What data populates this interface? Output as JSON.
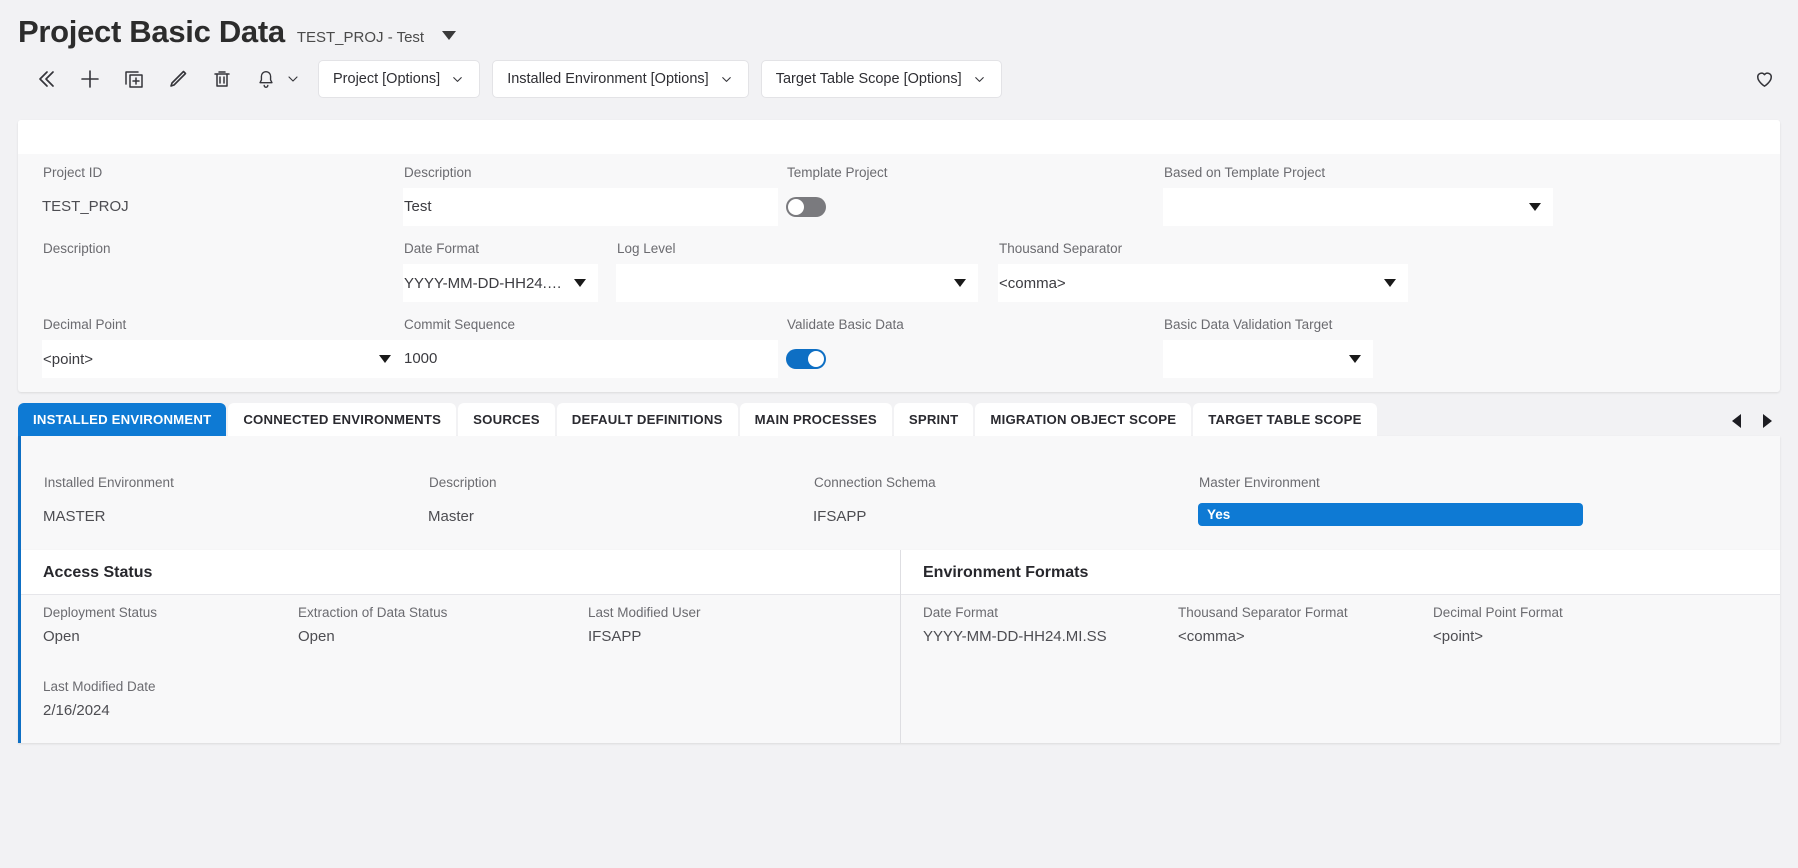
{
  "header": {
    "title": "Project Basic Data",
    "subtitle": "TEST_PROJ - Test"
  },
  "toolbar": {
    "icons": [
      {
        "name": "collapse-icon",
        "glyph": "chevrons-left"
      },
      {
        "name": "new-icon",
        "glyph": "plus"
      },
      {
        "name": "duplicate-icon",
        "glyph": "copy-plus"
      },
      {
        "name": "edit-icon",
        "glyph": "pencil"
      },
      {
        "name": "delete-icon",
        "glyph": "trash"
      },
      {
        "name": "notification-icon",
        "glyph": "bell"
      }
    ],
    "option_buttons": [
      "Project [Options]",
      "Installed Environment [Options]",
      "Target Table Scope [Options]"
    ],
    "favorite_icon": "heart-icon"
  },
  "form": {
    "row1": [
      {
        "label": "Project ID",
        "value": "TEST_PROJ",
        "type": "readonly"
      },
      {
        "label": "Description",
        "value": "Test",
        "type": "input"
      },
      {
        "label": "Template Project",
        "value": "",
        "type": "toggle",
        "on": false
      },
      {
        "label": "Based on Template Project",
        "value": "",
        "type": "select"
      }
    ],
    "row2": [
      {
        "label": "Description",
        "value": "",
        "type": "readonly"
      },
      {
        "label": "Date Format",
        "value": "YYYY-MM-DD-HH24.MI...",
        "type": "select"
      },
      {
        "label": "Log Level",
        "value": "",
        "type": "select"
      },
      {
        "label": "Thousand Separator",
        "value": "<comma>",
        "type": "select"
      }
    ],
    "row3": [
      {
        "label": "Decimal Point",
        "value": "<point>",
        "type": "select"
      },
      {
        "label": "Commit Sequence",
        "value": "1000",
        "type": "input"
      },
      {
        "label": "Validate Basic Data",
        "value": "",
        "type": "toggle",
        "on": true
      },
      {
        "label": "Basic Data Validation Target",
        "value": "",
        "type": "select"
      }
    ]
  },
  "tabs": [
    {
      "label": "INSTALLED ENVIRONMENT",
      "active": true
    },
    {
      "label": "CONNECTED ENVIRONMENTS",
      "active": false
    },
    {
      "label": "SOURCES",
      "active": false
    },
    {
      "label": "DEFAULT DEFINITIONS",
      "active": false
    },
    {
      "label": "MAIN PROCESSES",
      "active": false
    },
    {
      "label": "SPRINT",
      "active": false
    },
    {
      "label": "MIGRATION OBJECT SCOPE",
      "active": false
    },
    {
      "label": "TARGET TABLE SCOPE",
      "active": false
    }
  ],
  "tab_nav": {
    "prev_icon": "arrow-left-icon",
    "next_icon": "arrow-right-icon"
  },
  "installed_environment": {
    "fields": [
      {
        "label": "Installed Environment",
        "value": "MASTER"
      },
      {
        "label": "Description",
        "value": "Master"
      },
      {
        "label": "Connection Schema",
        "value": "IFSAPP"
      },
      {
        "label": "Master Environment",
        "value": "Yes",
        "badge": true
      }
    ]
  },
  "access_status": {
    "title": "Access Status",
    "fields": [
      {
        "label": "Deployment Status",
        "value": "Open"
      },
      {
        "label": "Extraction of Data Status",
        "value": "Open"
      },
      {
        "label": "Last Modified User",
        "value": "IFSAPP"
      }
    ],
    "fields2": [
      {
        "label": "Last Modified Date",
        "value": "2/16/2024"
      }
    ]
  },
  "environment_formats": {
    "title": "Environment Formats",
    "fields": [
      {
        "label": "Date Format",
        "value": "YYYY-MM-DD-HH24.MI.SS"
      },
      {
        "label": "Thousand Separator Format",
        "value": "<comma>"
      },
      {
        "label": "Decimal Point Format",
        "value": "<point>"
      }
    ]
  },
  "colors": {
    "accent": "#0e7ad4",
    "toggle_on": "#0e6fc4",
    "toggle_off": "#7a7a7e",
    "page_bg": "#f2f2f4",
    "card_bg": "#f8f8f9"
  }
}
